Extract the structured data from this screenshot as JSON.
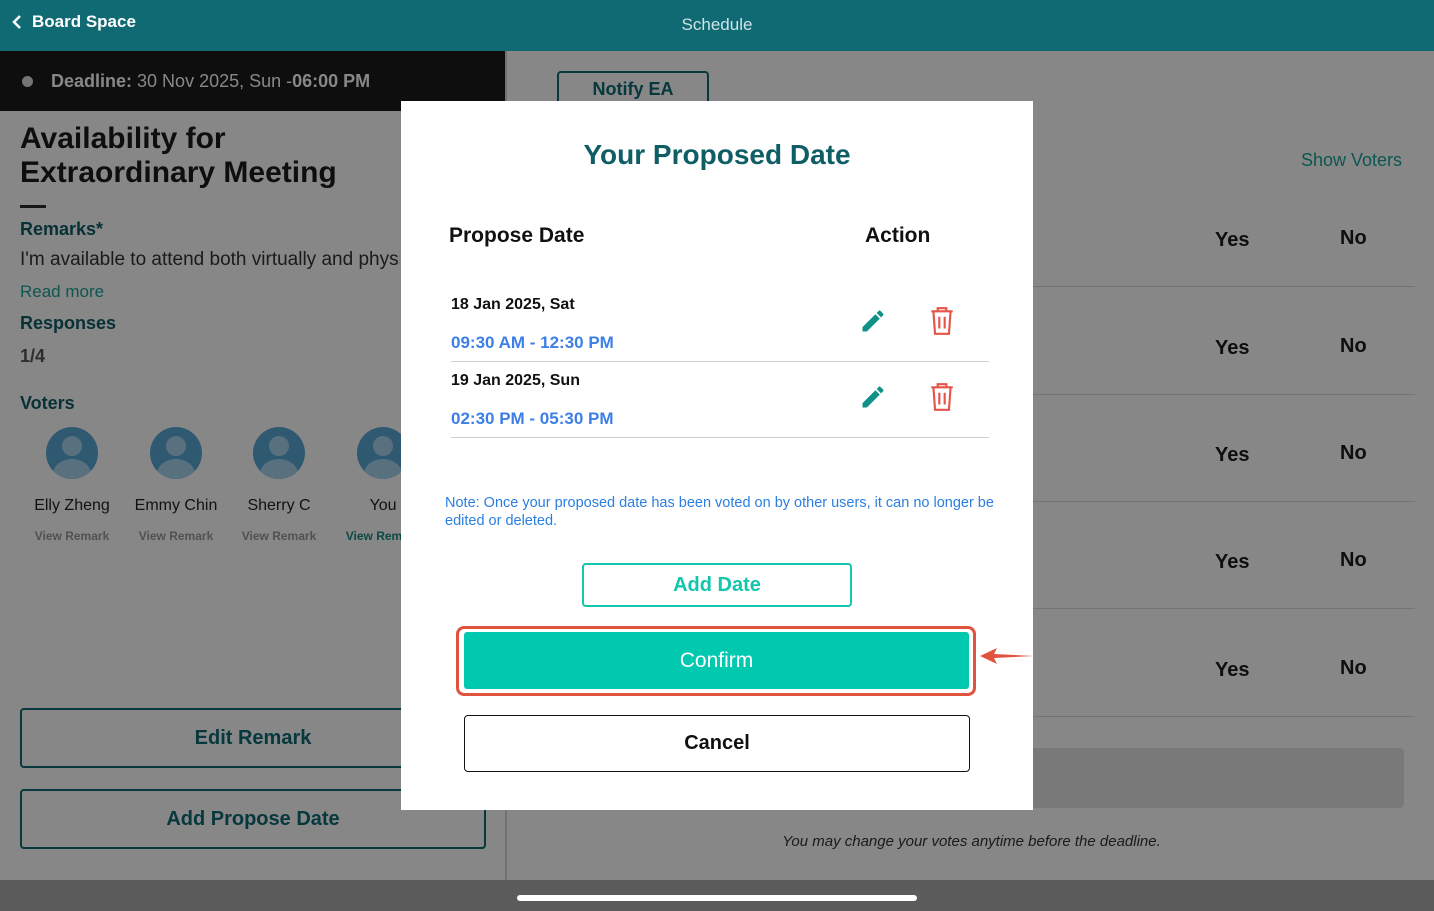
{
  "header": {
    "back_label": "Board Space",
    "title": "Schedule"
  },
  "left_panel": {
    "deadline": {
      "label": "Deadline:",
      "date": "30 Nov 2025, Sun - ",
      "time": "06:00 PM"
    },
    "meeting_title": "Availability for Extraordinary Meeting",
    "remarks_label": "Remarks*",
    "remark_text": "I'm available to attend both virtually and physically",
    "read_more": "Read more",
    "responses_label": "Responses",
    "responses_count": "1/4",
    "voters_label": "Voters",
    "voters": [
      {
        "name": "Elly Zheng",
        "action": "View Remark"
      },
      {
        "name": "Emmy Chin",
        "action": "View Remark"
      },
      {
        "name": "Sherry C",
        "action": "View Remark"
      },
      {
        "name": "You",
        "action": "View Remark"
      }
    ],
    "edit_remark_label": "Edit Remark",
    "add_propose_date_label": "Add Propose Date"
  },
  "right_panel": {
    "notify_label": "Notify EA",
    "show_voters_label": "Show Voters",
    "rows": [
      {
        "yes": "Yes",
        "no": "No"
      },
      {
        "yes": "Yes",
        "no": "No"
      },
      {
        "yes": "Yes",
        "no": "No"
      },
      {
        "yes": "Yes",
        "no": "No"
      },
      {
        "yes": "Yes",
        "no": "No"
      }
    ],
    "footer_hint": "You may change your votes anytime before the deadline."
  },
  "modal": {
    "title": "Your Proposed Date",
    "col_date": "Propose Date",
    "col_action": "Action",
    "proposals": [
      {
        "date": "18 Jan 2025, Sat",
        "time": "09:30 AM - 12:30 PM"
      },
      {
        "date": "19 Jan 2025, Sun",
        "time": "02:30 PM - 05:30 PM"
      }
    ],
    "note": "Note: Once your proposed date has been voted on by other users, it can no longer be edited or deleted.",
    "add_date_label": "Add Date",
    "confirm_label": "Confirm",
    "cancel_label": "Cancel"
  },
  "colors": {
    "header_bg": "#0f6a73",
    "accent_teal": "#00c9b0",
    "time_blue": "#3d7fe6",
    "delete_red": "#e5544a",
    "highlight_red": "#e0533f"
  },
  "icons": [
    "chevron-left-icon",
    "clock-dot-icon",
    "avatar-icon",
    "pencil-icon",
    "trash-icon",
    "arrow-pointer-icon"
  ]
}
